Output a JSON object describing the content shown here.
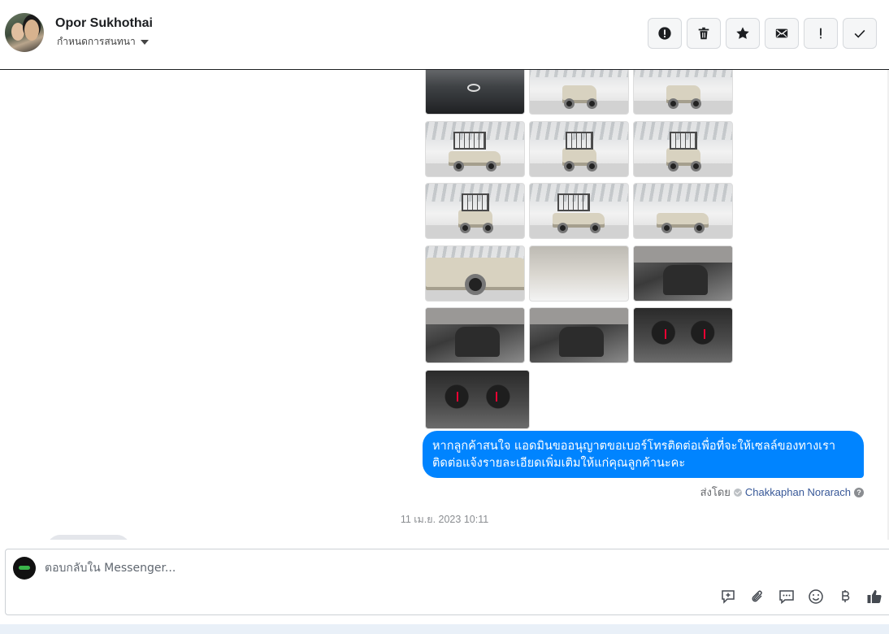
{
  "header": {
    "contact_name": "Opor Sukhothai",
    "assign_label": "กำหนดการสนทนา",
    "actions": [
      {
        "name": "spam-button",
        "icon": "alert-circle-icon",
        "glyph": "!"
      },
      {
        "name": "delete-button",
        "icon": "trash-icon"
      },
      {
        "name": "star-button",
        "icon": "star-icon"
      },
      {
        "name": "mark-unread-button",
        "icon": "envelope-icon"
      },
      {
        "name": "follow-up-button",
        "icon": "exclamation-icon",
        "glyph": "!"
      },
      {
        "name": "mark-done-button",
        "icon": "checkmark-icon"
      }
    ]
  },
  "thread": {
    "message_text": "หากลูกค้าสนใจ แอดมินขออนุญาตขอเบอร์โทรติดต่อเพื่อที่จะให้เซลล์ของทางเราติดต่อแจ้งรายละเอียดเพิ่มเติมให้แก่คุณลูกค้านะคะ",
    "sent_by_label": "ส่งโดย",
    "sent_by_name": "Chakkaphan Norarach",
    "timestamp": "11 เม.ย. 2023 10:11",
    "photo_count": 16
  },
  "composer": {
    "placeholder": "ตอบกลับใน Messenger...",
    "tools": [
      "add-note-icon",
      "attachment-icon",
      "saved-reply-icon",
      "emoji-icon",
      "baht-payment-icon",
      "thumbs-up-icon"
    ]
  },
  "colors": {
    "bubble": "#0084ff",
    "header_border": "#1c1e21",
    "sender_name": "#385898"
  }
}
